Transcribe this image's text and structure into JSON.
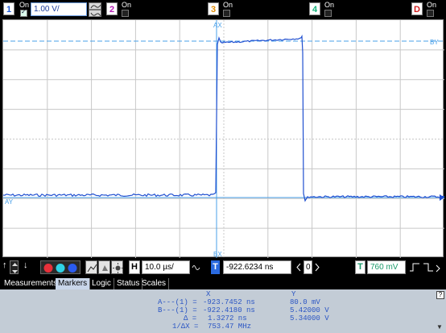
{
  "channels": [
    {
      "num": "1",
      "state": "On",
      "color": "#1e5bd8",
      "checked": true,
      "scale": "1.00 V/"
    },
    {
      "num": "2",
      "state": "On",
      "color": "#b41bb4",
      "checked": false
    },
    {
      "num": "3",
      "state": "On",
      "color": "#e08a00",
      "checked": false
    },
    {
      "num": "4",
      "state": "On",
      "color": "#14b27a",
      "checked": false
    },
    {
      "num": "D",
      "state": "On",
      "color": "#d32020",
      "checked": false
    }
  ],
  "markers": {
    "ax": "AX",
    "bx": "BX",
    "ay": "AY",
    "by": "BY"
  },
  "controls": {
    "h_label": "H",
    "timebase": "10.0 µs/",
    "t_icon_label": "T",
    "delay": "-922.6234 ns",
    "zero": "0",
    "trigger_label": "T",
    "trigger_level": "760 mV"
  },
  "tabs": [
    {
      "label": "Measurements",
      "active": false
    },
    {
      "label": "Markers",
      "active": true
    },
    {
      "label": "Logic",
      "active": false
    },
    {
      "label": "Status",
      "active": false
    },
    {
      "label": "Scales",
      "active": false
    }
  ],
  "readout": {
    "col_x": "X",
    "col_y": "Y",
    "rows": [
      {
        "label": "A---(1) =",
        "x": "-923.7452 ns",
        "y": "80.0 mV"
      },
      {
        "label": "B---(1) =",
        "x": "-922.4180 ns",
        "y": "5.42000 V"
      },
      {
        "label": "Δ =",
        "x": "1.3272 ns",
        "y": "5.34000 V"
      },
      {
        "label": "1/ΔX =",
        "x": "753.47 MHz",
        "y": ""
      }
    ]
  },
  "help": "?",
  "colors": {
    "trace": "#1f4fd0",
    "marker": "#4aa0e8",
    "grid": "#c8c8c8",
    "panel": "#c3ccd6"
  }
}
